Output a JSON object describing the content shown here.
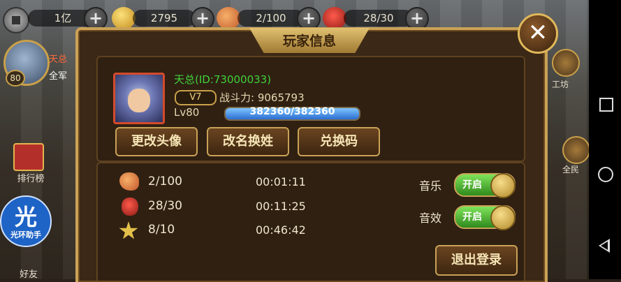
{
  "top_bar": {
    "currency1_value": "1亿",
    "currency2_value": "2795",
    "stamina_value": "2/100",
    "energy_value": "28/30",
    "plus_label": "+"
  },
  "side": {
    "avatar_level": "80",
    "tag1": "天总",
    "tag2": "全军",
    "rank_label": "排行榜",
    "helper_big": "光",
    "helper_small": "光环助手",
    "friend_label": "好友",
    "right_label1": "工坊",
    "right_label2": "全民"
  },
  "dialog": {
    "title": "玩家信息",
    "close_label": "✕",
    "player_name": "天总(ID:73000033)",
    "vip": "V7",
    "power_label": "战斗力: 9065793",
    "level": "Lv80",
    "exp_text": "382360/382360",
    "exp_fraction": 1.0,
    "buttons": {
      "change_avatar": "更改头像",
      "rename": "改名换姓",
      "redeem": "兑换码"
    },
    "resources": [
      {
        "icon": "drumstick-icon",
        "value": "2/100",
        "timer": "00:01:11"
      },
      {
        "icon": "jar-icon",
        "value": "28/30",
        "timer": "00:11:25"
      },
      {
        "icon": "star-icon",
        "value": "8/10",
        "timer": "00:46:42"
      }
    ],
    "settings": {
      "music_label": "音乐",
      "music_state": "开启",
      "sfx_label": "音效",
      "sfx_state": "开启"
    },
    "logout_label": "退出登录"
  },
  "colors": {
    "name_green": "#3fd23a",
    "accent_gold": "#caa257",
    "toggle_green": "#2f8a1c"
  }
}
